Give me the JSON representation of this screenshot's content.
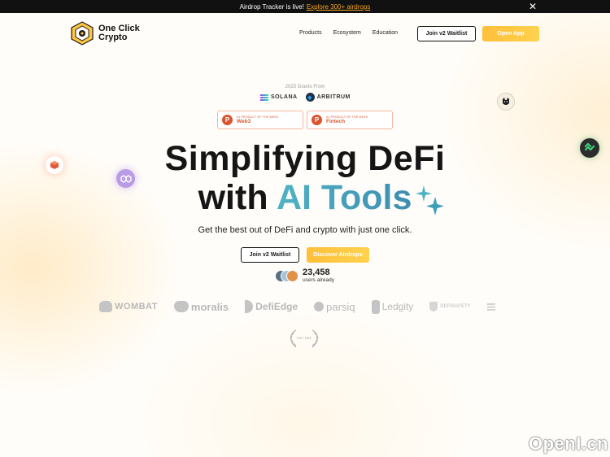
{
  "announcement": {
    "text": "Airdrop Tracker is live!",
    "link": "Explore 300+ airdrops",
    "close": "✕"
  },
  "header": {
    "logo_line1": "One Click",
    "logo_line2": "Crypto",
    "nav": [
      "Products",
      "Ecosystem",
      "Education"
    ],
    "waitlist_label": "Join v2 Waitlist",
    "open_app_label": "Open App"
  },
  "grants": {
    "label": "2023 Grants From",
    "solana": "SOLANA",
    "arbitrum": "ARBITRUM"
  },
  "badges": [
    {
      "small": "#1 PRODUCT OF THE WEEK",
      "big": "Web3"
    },
    {
      "small": "#1 PRODUCT OF THE WEEK",
      "big": "Fintech"
    }
  ],
  "hero": {
    "line1": "Simplifying DeFi",
    "line2_plain": "with ",
    "line2_highlight": "AI Tools",
    "subtitle": "Get the best out of DeFi and crypto with just one click.",
    "waitlist_label": "Join v2 Waitlist",
    "airdrops_label": "Discover Airdrops"
  },
  "users": {
    "count": "23,458",
    "label": "users already"
  },
  "partners": [
    "WOMBAT",
    "moralis",
    "DefiEdge",
    "parsiq",
    "Ledgity",
    "DEFISAFETY"
  ],
  "laurel": {
    "text": "EST / 2019"
  },
  "watermark": "OpenI.cn",
  "colors": {
    "accent": "#ffc640",
    "highlight_start": "#4fb3c4",
    "highlight_end": "#3d8db2",
    "product_hunt": "#da552f"
  }
}
